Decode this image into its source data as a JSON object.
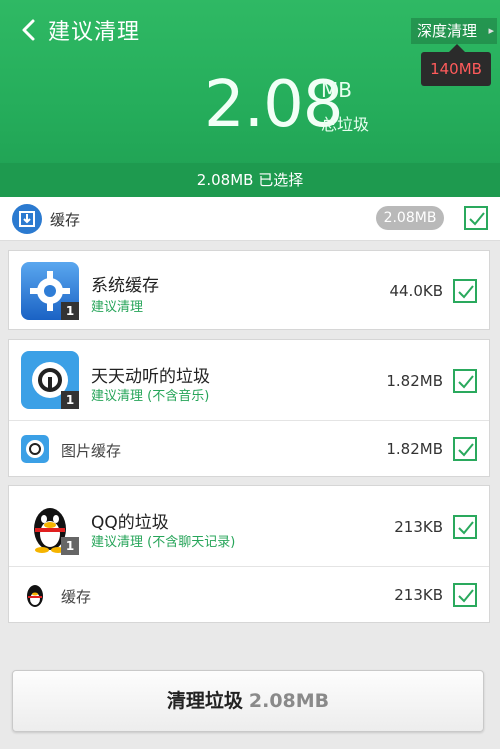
{
  "header": {
    "title": "建议清理",
    "deep_clean_label": "深度清理",
    "deep_clean_size": "140MB",
    "total_size": "2.08",
    "total_unit": "MB",
    "total_label": "总垃圾",
    "selected_text": "2.08MB 已选择"
  },
  "cache_row": {
    "label": "缓存",
    "size": "2.08MB",
    "checked": true
  },
  "apps": [
    {
      "name": "系统缓存",
      "subtitle": "建议清理",
      "size": "44.0KB",
      "badge": "1",
      "checked": true
    },
    {
      "name": "天天动听的垃圾",
      "subtitle": "建议清理 (不含音乐)",
      "size": "1.82MB",
      "badge": "1",
      "checked": true,
      "sub_items": [
        {
          "label": "图片缓存",
          "size": "1.82MB",
          "checked": true
        }
      ]
    },
    {
      "name": "QQ的垃圾",
      "subtitle": "建议清理 (不含聊天记录)",
      "size": "213KB",
      "badge": "1",
      "checked": true,
      "sub_items": [
        {
          "label": "缓存",
          "size": "213KB",
          "checked": true
        }
      ]
    }
  ],
  "footer": {
    "clean_label": "清理垃圾",
    "clean_amount": "2.08MB"
  },
  "colors": {
    "accent_green": "#25ad5b",
    "tooltip_red": "#ff5b5b"
  }
}
